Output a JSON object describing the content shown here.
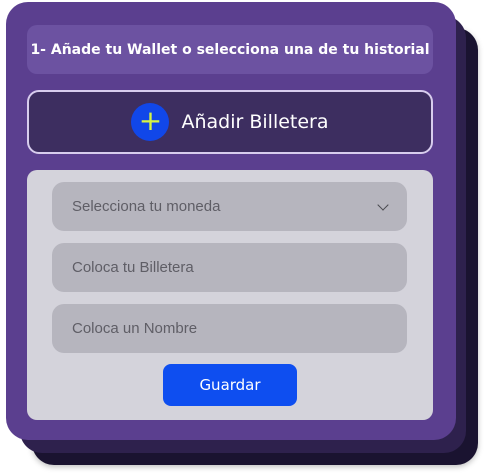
{
  "step": {
    "title": "1- Añade tu Wallet o selecciona una de tu historial"
  },
  "add_wallet": {
    "icon": "plus-icon",
    "icon_glyph": "+",
    "label": "Añadir Billetera"
  },
  "form": {
    "currency_select": {
      "placeholder": "Selecciona tu moneda",
      "icon": "chevron-down-icon"
    },
    "wallet_input": {
      "placeholder": "Coloca tu Billetera"
    },
    "name_input": {
      "placeholder": "Coloca un Nombre"
    },
    "save_label": "Guardar"
  },
  "colors": {
    "card": "#5b3f8f",
    "header_bg": "#6c52a1",
    "add_button_bg": "#3d2e60",
    "accent_blue": "#0e4ef0",
    "plus_color": "#d7f542",
    "form_bg": "#d4d3db",
    "field_bg": "#b6b5be"
  }
}
